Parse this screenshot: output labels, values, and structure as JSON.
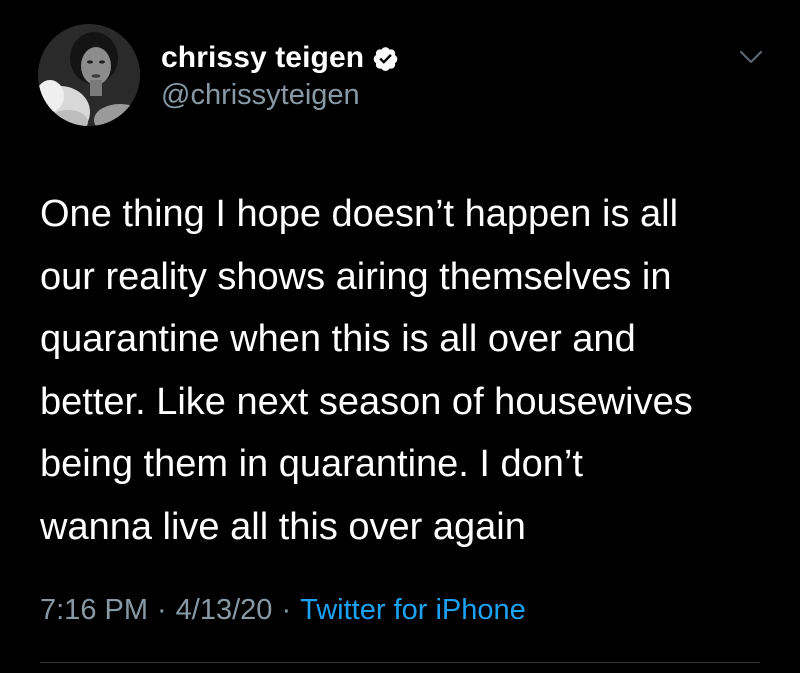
{
  "tweet": {
    "author": {
      "display_name": "chrissy teigen",
      "handle": "@chrissyteigen",
      "verified": true
    },
    "text_lines": [
      "One thing I hope doesn’t happen is all",
      "our reality shows airing themselves in",
      "quarantine when this is all over and",
      "better. Like next season of housewives",
      "being them in quarantine. I don’t",
      "wanna live all this over again"
    ],
    "time": "7:16 PM",
    "date": "4/13/20",
    "separator": "·",
    "source": "Twitter for iPhone"
  },
  "icons": {
    "verified": "verified-badge-icon",
    "menu": "chevron-down-icon"
  },
  "colors": {
    "background": "#000000",
    "text": "#ffffff",
    "secondary_text": "#8899a6",
    "link": "#1da1f2"
  }
}
